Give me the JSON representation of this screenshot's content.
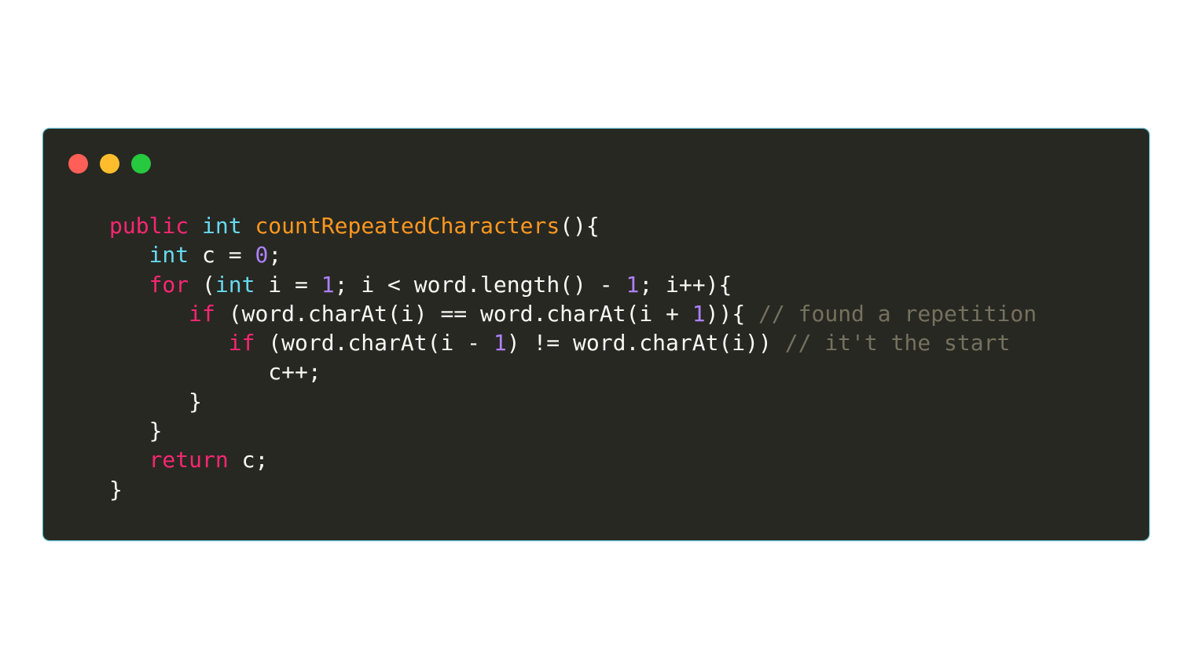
{
  "window": {
    "buttons": [
      {
        "name": "close",
        "color": "#ff5f56"
      },
      {
        "name": "minimize",
        "color": "#ffbd2e"
      },
      {
        "name": "zoom",
        "color": "#27c93f"
      }
    ]
  },
  "theme": {
    "background": "#272822",
    "border": "#5fb7c9",
    "keyword": "#f92672",
    "type": "#66d9ef",
    "function": "#fd971f",
    "number": "#ae81ff",
    "comment": "#75715e",
    "plain": "#f8f8f2"
  },
  "code": {
    "language": "java",
    "lines": [
      [
        {
          "t": "public",
          "k": "kw"
        },
        {
          "t": " ",
          "k": "pl"
        },
        {
          "t": "int",
          "k": "ty"
        },
        {
          "t": " ",
          "k": "pl"
        },
        {
          "t": "countRepeatedCharacters",
          "k": "fn"
        },
        {
          "t": "(){",
          "k": "pl"
        }
      ],
      [
        {
          "t": "   ",
          "k": "pl"
        },
        {
          "t": "int",
          "k": "ty"
        },
        {
          "t": " c = ",
          "k": "pl"
        },
        {
          "t": "0",
          "k": "num"
        },
        {
          "t": ";",
          "k": "pl"
        }
      ],
      [
        {
          "t": "   ",
          "k": "pl"
        },
        {
          "t": "for",
          "k": "kw"
        },
        {
          "t": " (",
          "k": "pl"
        },
        {
          "t": "int",
          "k": "ty"
        },
        {
          "t": " i = ",
          "k": "pl"
        },
        {
          "t": "1",
          "k": "num"
        },
        {
          "t": "; i < word.length() - ",
          "k": "pl"
        },
        {
          "t": "1",
          "k": "num"
        },
        {
          "t": "; i++){",
          "k": "pl"
        }
      ],
      [
        {
          "t": "      ",
          "k": "pl"
        },
        {
          "t": "if",
          "k": "kw"
        },
        {
          "t": " (word.charAt(i) == word.charAt(i + ",
          "k": "pl"
        },
        {
          "t": "1",
          "k": "num"
        },
        {
          "t": ")){ ",
          "k": "pl"
        },
        {
          "t": "// found a repetition",
          "k": "cm"
        }
      ],
      [
        {
          "t": "         ",
          "k": "pl"
        },
        {
          "t": "if",
          "k": "kw"
        },
        {
          "t": " (word.charAt(i - ",
          "k": "pl"
        },
        {
          "t": "1",
          "k": "num"
        },
        {
          "t": ") != word.charAt(i)) ",
          "k": "pl"
        },
        {
          "t": "// it't the start",
          "k": "cm"
        }
      ],
      [
        {
          "t": "            c++;",
          "k": "pl"
        }
      ],
      [
        {
          "t": "      }",
          "k": "pl"
        }
      ],
      [
        {
          "t": "   }",
          "k": "pl"
        }
      ],
      [
        {
          "t": "   ",
          "k": "pl"
        },
        {
          "t": "return",
          "k": "kw"
        },
        {
          "t": " c;",
          "k": "pl"
        }
      ],
      [
        {
          "t": "}",
          "k": "pl"
        }
      ]
    ]
  }
}
